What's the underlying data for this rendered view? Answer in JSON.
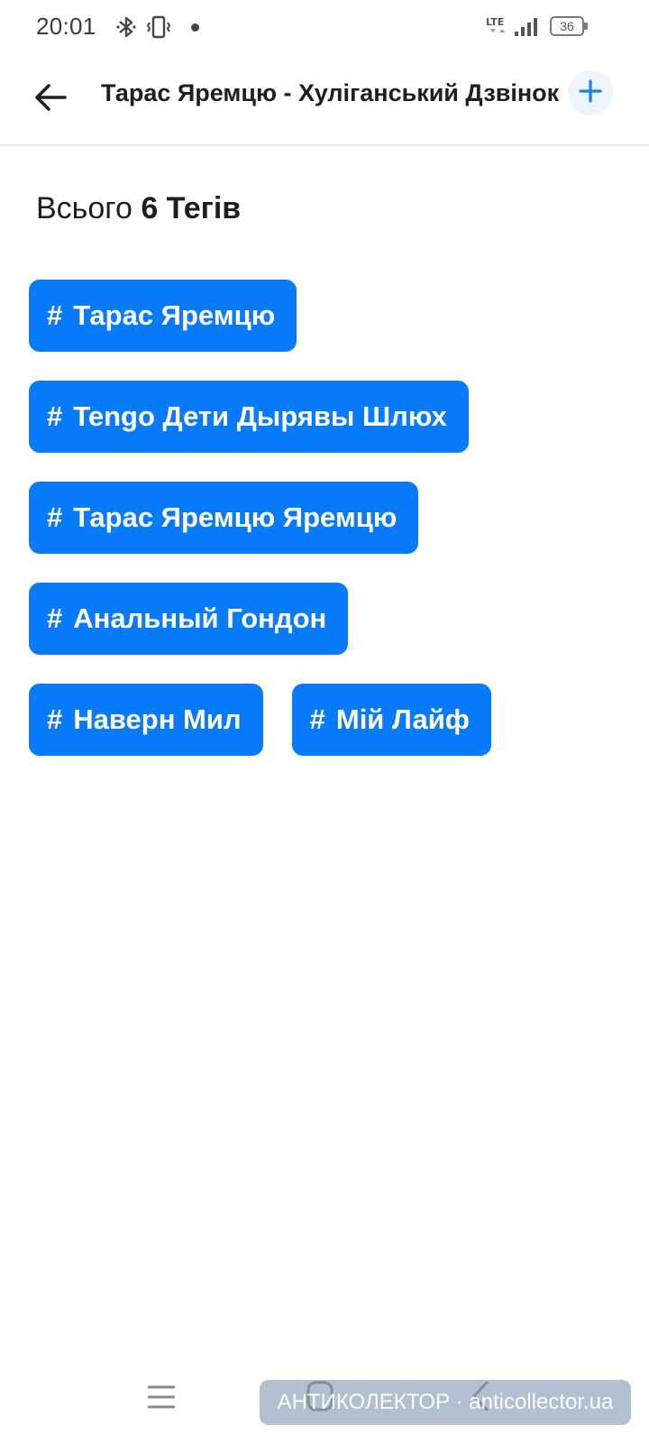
{
  "status_bar": {
    "time": "20:01",
    "network_label": "LTE",
    "battery_level": "36",
    "icons": [
      "bluetooth-icon",
      "vibrate-icon",
      "notification-dot-icon",
      "lte-icon",
      "signal-icon",
      "battery-icon"
    ]
  },
  "header": {
    "title": "Тарас Яремцю - Хуліганський Дзвінок",
    "back_icon": "arrow-left-icon",
    "add_icon": "plus-icon"
  },
  "summary": {
    "prefix": "Всього",
    "count_label": "6 Тегів"
  },
  "tags": [
    {
      "hash": "#",
      "label": "Тарас Яремцю"
    },
    {
      "hash": "#",
      "label": "Tengo Дети Дырявы Шлюх"
    },
    {
      "hash": "#",
      "label": "Тарас Яремцю Яремцю"
    },
    {
      "hash": "#",
      "label": "Анальный Гондон"
    },
    {
      "hash": "#",
      "label": "Наверн Мил"
    },
    {
      "hash": "#",
      "label": "Мій Лайф"
    }
  ],
  "nav_bar": {
    "icons": [
      "menu-icon",
      "home-icon",
      "back-icon"
    ]
  },
  "watermark": {
    "text": "АНТИКОЛЕКТОР · anticollector.ua"
  },
  "colors": {
    "tag_background": "#087bfa",
    "tag_text": "#ffffff",
    "accent": "#1a7ff0"
  }
}
